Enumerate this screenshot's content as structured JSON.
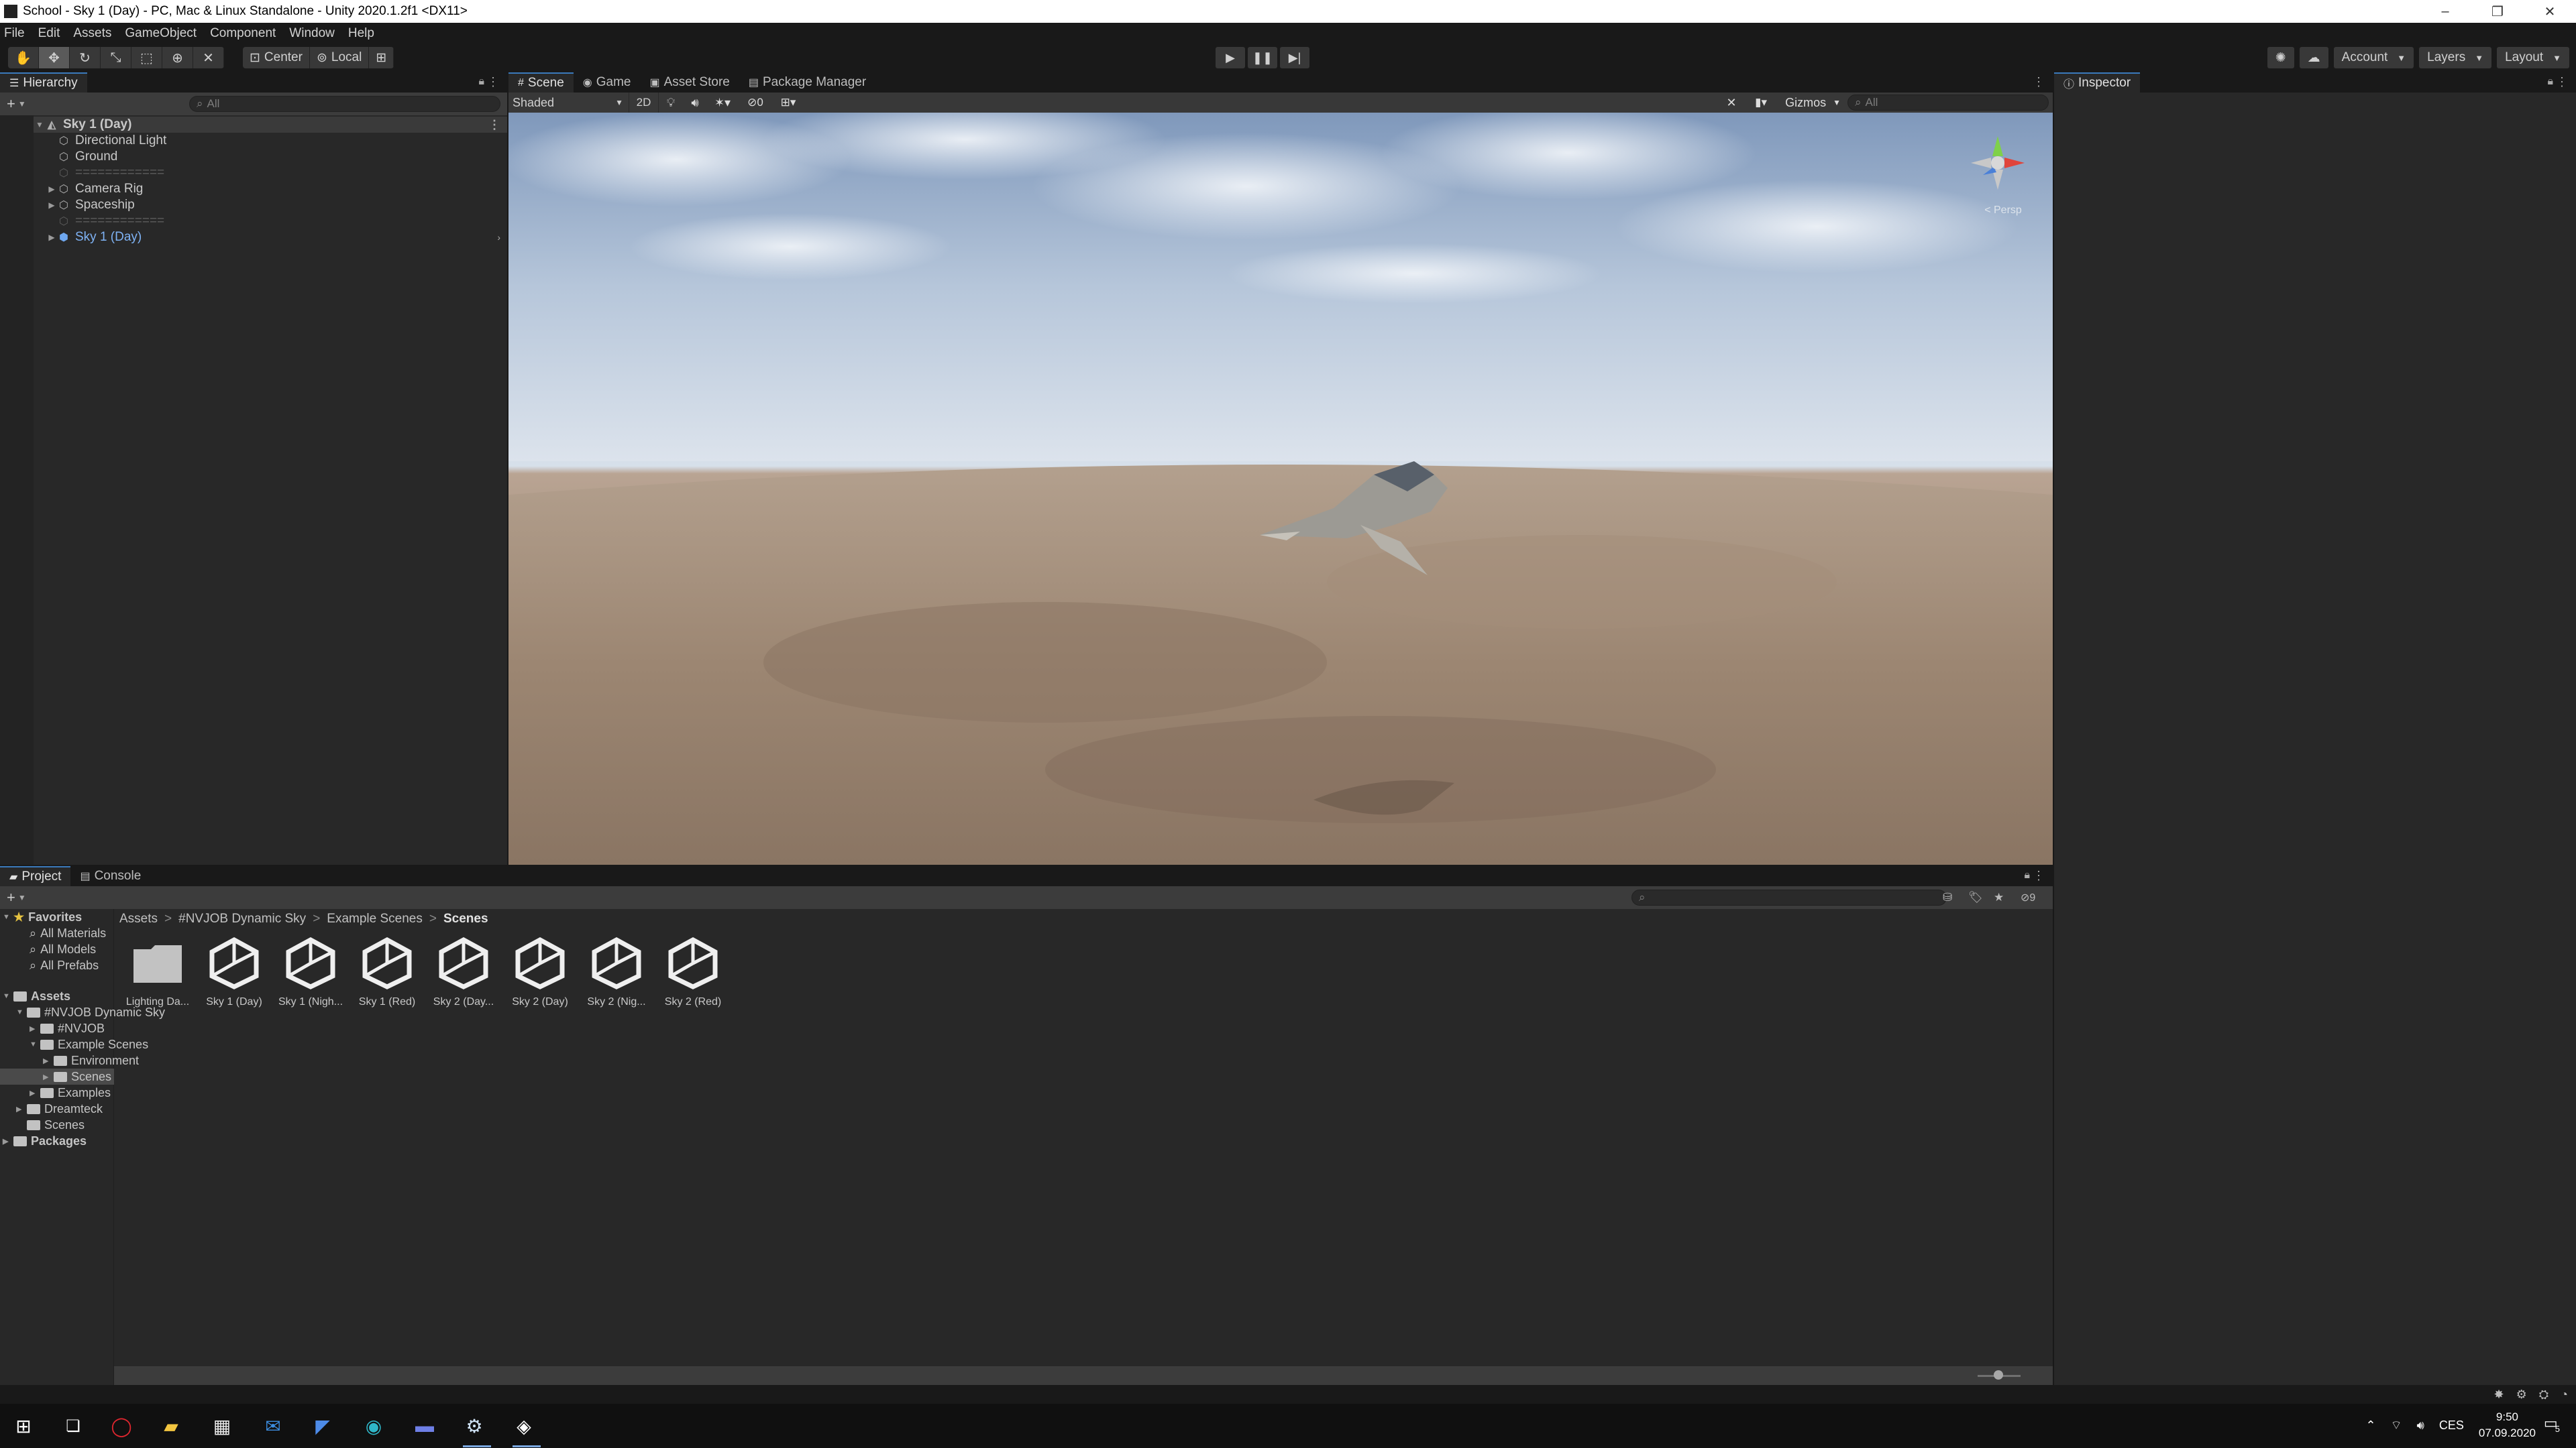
{
  "window": {
    "title": "School - Sky 1 (Day) - PC, Mac & Linux Standalone - Unity 2020.1.2f1 <DX11>",
    "controls": [
      "–",
      "❐",
      "✕"
    ]
  },
  "menu": [
    "File",
    "Edit",
    "Assets",
    "GameObject",
    "Component",
    "Window",
    "Help"
  ],
  "toolbar": {
    "pivot_center": "Center",
    "pivot_local": "Local",
    "account": "Account",
    "layers": "Layers",
    "layout": "Layout"
  },
  "hierarchy": {
    "tab": "Hierarchy",
    "search_placeholder": "All",
    "items": [
      {
        "label": "Sky 1 (Day)"
      },
      {
        "label": "Directional Light"
      },
      {
        "label": "Ground"
      },
      {
        "label": "============"
      },
      {
        "label": "Camera Rig"
      },
      {
        "label": "Spaceship"
      },
      {
        "label": "============"
      },
      {
        "label": "Sky 1 (Day)"
      }
    ]
  },
  "scene": {
    "tabs": [
      "Scene",
      "Game",
      "Asset Store",
      "Package Manager"
    ],
    "shading_mode": "Shaded",
    "mode_2d": "2D",
    "hidden_count": "0",
    "gizmos": "Gizmos",
    "search_placeholder": "All",
    "persp_label": "< Persp"
  },
  "inspector": {
    "tab": "Inspector"
  },
  "project": {
    "tabs": [
      "Project",
      "Console"
    ],
    "favorites_label": "Favorites",
    "favorites": [
      "All Materials",
      "All Models",
      "All Prefabs"
    ],
    "tree": [
      {
        "label": "Assets"
      },
      {
        "label": "#NVJOB Dynamic Sky"
      },
      {
        "label": "#NVJOB"
      },
      {
        "label": "Example Scenes"
      },
      {
        "label": "Environment"
      },
      {
        "label": "Scenes"
      },
      {
        "label": "Examples"
      },
      {
        "label": "Dreamteck"
      },
      {
        "label": "Scenes"
      },
      {
        "label": "Packages"
      }
    ],
    "breadcrumb": [
      "Assets",
      "#NVJOB Dynamic Sky",
      "Example Scenes",
      "Scenes"
    ],
    "hidden_count": "9",
    "assets": [
      {
        "label": "Lighting Da...",
        "type": "folder"
      },
      {
        "label": "Sky 1 (Day)",
        "type": "scene"
      },
      {
        "label": "Sky 1 (Nigh...",
        "type": "scene"
      },
      {
        "label": "Sky 1 (Red)",
        "type": "scene"
      },
      {
        "label": "Sky 2 (Day...",
        "type": "scene"
      },
      {
        "label": "Sky 2 (Day)",
        "type": "scene"
      },
      {
        "label": "Sky 2 (Nig...",
        "type": "scene"
      },
      {
        "label": "Sky 2 (Red)",
        "type": "scene"
      }
    ]
  },
  "taskbar": {
    "language": "CES",
    "time": "9:50",
    "date": "07.09.2020",
    "notifications": "5"
  }
}
